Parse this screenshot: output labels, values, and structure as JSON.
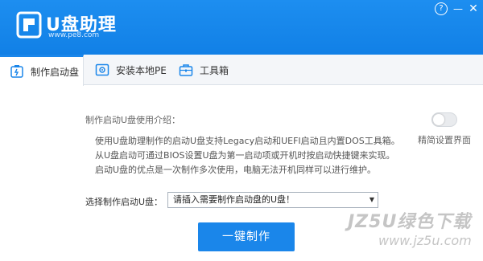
{
  "app": {
    "title": "U盘助理",
    "subtitle": "www.pe8.com"
  },
  "window_controls": {
    "help": "?",
    "minimize": "—",
    "close": "✕"
  },
  "tabs": [
    {
      "label": "制作启动盘",
      "icon": "usb-icon",
      "active": true
    },
    {
      "label": "安装本地PE",
      "icon": "gear-box-icon",
      "active": false
    },
    {
      "label": "工具箱",
      "icon": "toolbox-icon",
      "active": false
    }
  ],
  "intro": {
    "title": "制作启动U盘使用介绍：",
    "lines": [
      "使用U盘助理制作的启动U盘支持Legacy启动和UEFI启动且内置DOS工具箱。",
      "从U盘启动可通过BIOS设置U盘为第一启动项或开机时按启动快捷键来实现。",
      "启动U盘的优点是一次制作多次使用，电脑无法开机同样可以进行维护。"
    ]
  },
  "settings_toggle": {
    "label": "精简设置界面",
    "on": false
  },
  "usb_select": {
    "label": "选择制作启动U盘：",
    "value": "请插入需要制作启动盘的U盘！"
  },
  "primary_action": {
    "label": "一键制作"
  },
  "watermark": {
    "main": "JZ5U绿色下载",
    "sub": "www.jz5u.com"
  },
  "colors": {
    "brand": "#1a86ea",
    "titlebar": "#1d8ef0"
  }
}
